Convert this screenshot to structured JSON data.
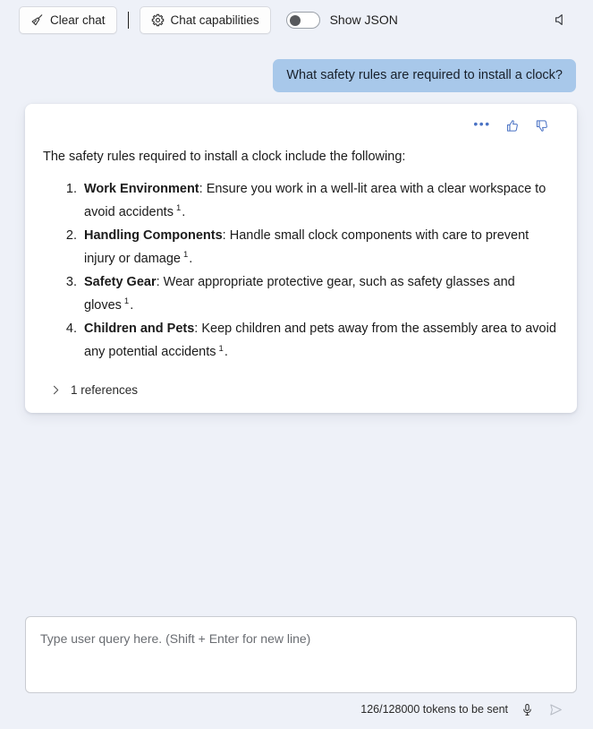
{
  "toolbar": {
    "clear_chat_label": "Clear chat",
    "clear_chat_icon": "broom-icon",
    "separator": "|",
    "chat_capabilities_label": "Chat capabilities",
    "chat_capabilities_icon": "gear-icon",
    "show_json_label": "Show JSON",
    "show_json_toggle_state": "off",
    "speaker_icon": "speaker-icon"
  },
  "conversation": {
    "user_message": "What safety rules are required to install a clock?",
    "assistant": {
      "actions": {
        "more_icon": "ellipsis-icon",
        "more_label": "•••",
        "thumbs_up_icon": "thumbs-up-icon",
        "thumbs_down_icon": "thumbs-down-icon"
      },
      "intro": "The safety rules required to install a clock include the following:",
      "items": [
        {
          "title": "Work Environment",
          "text": ": Ensure you work in a well-lit area with a clear workspace to avoid accidents",
          "citation": "1",
          "trailing": "."
        },
        {
          "title": "Handling Components",
          "text": ": Handle small clock components with care to prevent injury or damage",
          "citation": "1",
          "trailing": "."
        },
        {
          "title": "Safety Gear",
          "text": ": Wear appropriate protective gear, such as safety glasses and gloves",
          "citation": "1",
          "trailing": "."
        },
        {
          "title": "Children and Pets",
          "text": ": Keep children and pets away from the assembly area to avoid any potential accidents",
          "citation": "1",
          "trailing": "."
        }
      ],
      "references_label": "1 references",
      "references_icon": "chevron-right-icon"
    }
  },
  "composer": {
    "placeholder": "Type user query here. (Shift + Enter for new line)",
    "value": "",
    "token_count": "126/128000 tokens to be sent",
    "mic_icon": "microphone-icon",
    "send_icon": "send-icon"
  },
  "colors": {
    "background": "#eef1f8",
    "card": "#ffffff",
    "user_bubble": "#a8c8ea",
    "accent_blue": "#4a72c4",
    "text": "#1b1b1b"
  }
}
